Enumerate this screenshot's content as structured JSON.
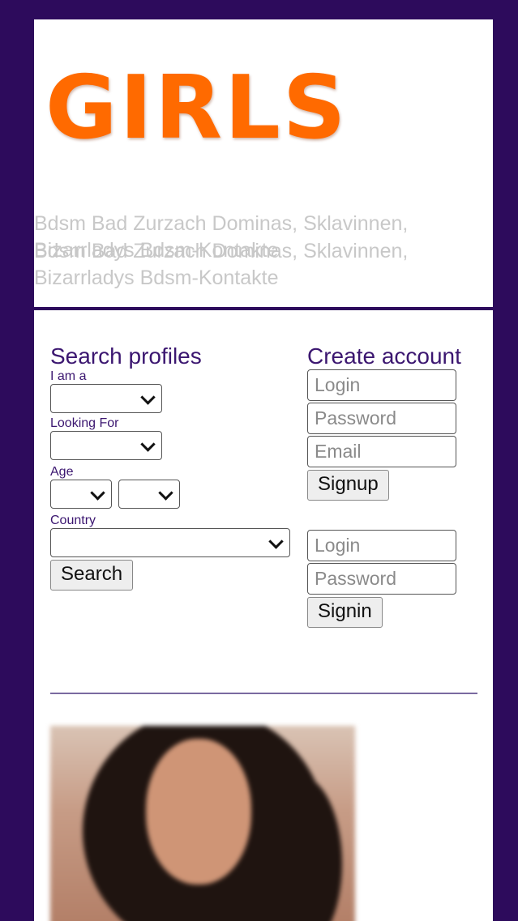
{
  "header": {
    "logo_text": "GIRLS",
    "tagline": "Bdsm Bad Zurzach Dominas, Sklavinnen, Bizarrladys Bdsm-Kontakte",
    "tagline_overlap": "Bdsm Bad Zurzach Dominas, Sklavinnen, Bizarrladys Bdsm-Kontakte"
  },
  "search": {
    "title": "Search profiles",
    "i_am_label": "I am a",
    "looking_for_label": "Looking For",
    "age_label": "Age",
    "country_label": "Country",
    "button": "Search"
  },
  "account": {
    "title": "Create account",
    "signup": {
      "login_placeholder": "Login",
      "password_placeholder": "Password",
      "email_placeholder": "Email",
      "button": "Signup"
    },
    "signin": {
      "login_placeholder": "Login",
      "password_placeholder": "Password",
      "button": "Signin"
    }
  },
  "colors": {
    "frame": "#2d0b5c",
    "logo": "#ff6a00",
    "heading": "#3b1670",
    "tagline": "#c8c8c8"
  }
}
